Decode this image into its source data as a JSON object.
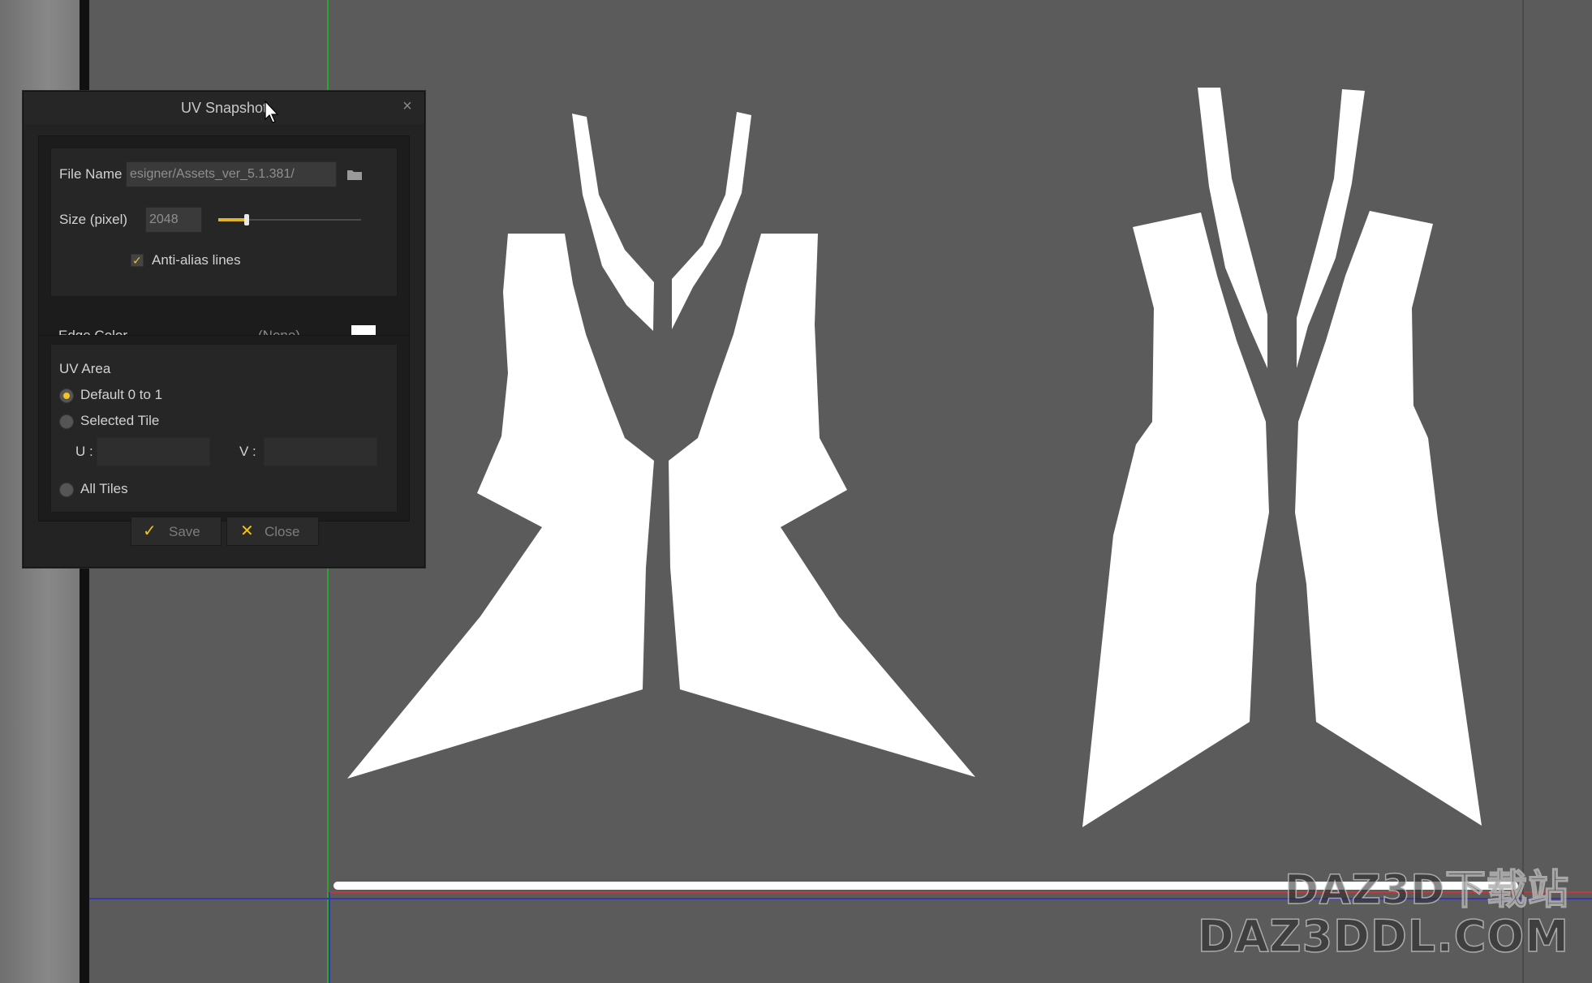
{
  "dialog": {
    "title": "UV Snapshot",
    "close_glyph": "×",
    "file_name_label": "File Name",
    "file_name_value": "esigner/Assets_ver_5.1.381/",
    "size_label": "Size (pixel)",
    "size_value": "2048",
    "size_slider_fraction": 0.2,
    "antialias_label": "Anti-alias lines",
    "antialias_checked": true,
    "edge_color_label": "Edge Color",
    "edge_color_value": "(None)",
    "edge_color_swatch": "#ffffff",
    "uv_area_label": "UV Area",
    "uv_options": [
      {
        "label": "Default 0 to 1",
        "checked": true
      },
      {
        "label": "Selected Tile",
        "checked": false
      },
      {
        "label": "All Tiles",
        "checked": false
      }
    ],
    "u_label": "U :",
    "v_label": "V :",
    "u_value": "",
    "v_value": "",
    "save_label": "Save",
    "close_label": "Close",
    "save_icon": "check-icon",
    "close_icon": "x-icon"
  },
  "watermark": {
    "line1": "DAZ3D下载站",
    "line2": "DAZ3DDL.COM"
  },
  "colors": {
    "canvas_bg": "#5b5b5b",
    "accent": "#f1c21d",
    "u_axis": "#cc3333",
    "v_axis": "#33bb33",
    "grid_axis": "#3333aa"
  }
}
